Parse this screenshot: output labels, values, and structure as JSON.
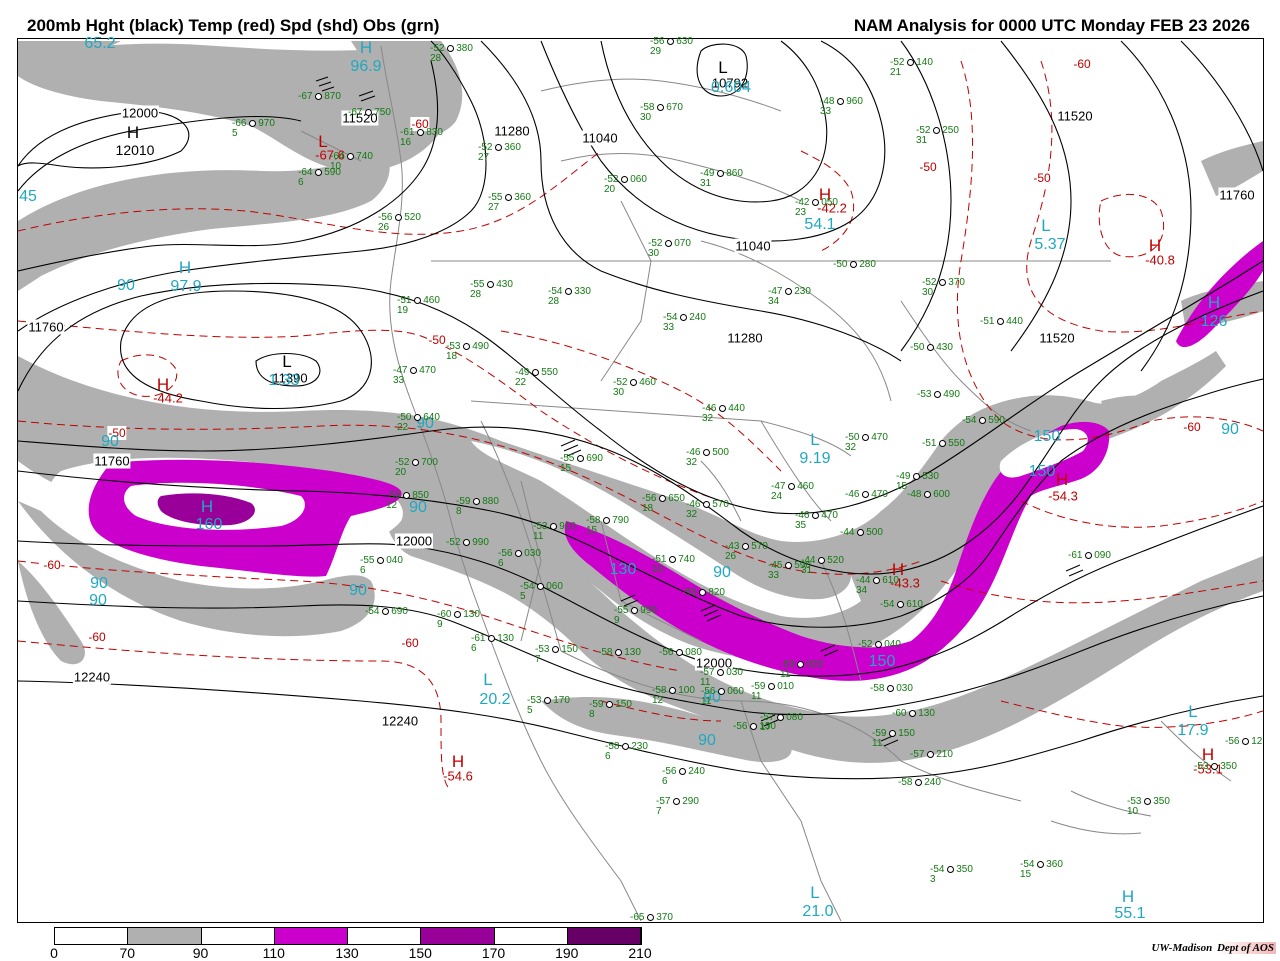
{
  "header": {
    "left_title": "200mb Hght (black) Temp (red) Spd (shd) Obs (grn)",
    "right_title": "NAM Analysis for 0000 UTC Monday  FEB 23 2026"
  },
  "colorbar": {
    "labels": [
      "0",
      "70",
      "90",
      "110",
      "130",
      "150",
      "170",
      "190",
      "210"
    ],
    "colors": [
      "#ffffff",
      "#b0b0b0",
      "#ffffff",
      "#cc00cc",
      "#ffffff",
      "#990099",
      "#ffffff",
      "#660066"
    ]
  },
  "credit": {
    "org": "UW-Madison",
    "dept": "Dept of AOS"
  },
  "colors": {
    "height": "#000000",
    "temp": "#c00000",
    "speed_label": "#20a8c0",
    "obs": "#137a13",
    "shade_70": "#b0b0b0",
    "shade_110": "#cc00cc",
    "shade_150": "#990099"
  },
  "centers": [
    {
      "type": "H",
      "value": "12010",
      "color": "height"
    },
    {
      "type": "H",
      "value": "-44.2",
      "color": "temp"
    },
    {
      "type": "L",
      "value": "11390",
      "color": "height"
    },
    {
      "type": "L",
      "value": "10792",
      "color": "height"
    },
    {
      "type": "L",
      "value": "-67.6",
      "color": "temp"
    },
    {
      "type": "H",
      "value": "-42.2",
      "color": "temp"
    },
    {
      "type": "H",
      "value": "-40.8",
      "color": "temp"
    },
    {
      "type": "H",
      "value": "-54.6",
      "color": "temp"
    },
    {
      "type": "H",
      "value": "-43.3",
      "color": "temp"
    },
    {
      "type": "H",
      "value": "-53.1",
      "color": "temp"
    },
    {
      "type": "H",
      "value": "-54.3",
      "color": "temp"
    },
    {
      "type": "H",
      "value": "96.9",
      "color": "speed"
    },
    {
      "type": "H",
      "value": "97.9",
      "color": "speed"
    },
    {
      "type": "H",
      "value": "160",
      "color": "speed"
    },
    {
      "type": "H",
      "value": "126",
      "color": "speed"
    },
    {
      "type": "H",
      "value": "55.1",
      "color": "speed"
    },
    {
      "type": "L",
      "value": "1.33",
      "color": "speed"
    },
    {
      "type": "L",
      "value": "0.604",
      "color": "speed"
    },
    {
      "type": "L",
      "value": "5.37",
      "color": "speed"
    },
    {
      "type": "L",
      "value": "9.19",
      "color": "speed"
    },
    {
      "type": "L",
      "value": "20.2",
      "color": "speed"
    },
    {
      "type": "L",
      "value": "17.9",
      "color": "speed"
    },
    {
      "type": "L",
      "value": "21.0",
      "color": "speed"
    },
    {
      "type": "L",
      "value": "54.1",
      "color": "speed"
    }
  ],
  "height_labels": [
    "12000",
    "12010",
    "11760",
    "11280",
    "11040",
    "11040",
    "11520",
    "11760",
    "11280",
    "11520",
    "12000",
    "12000",
    "12240",
    "12240",
    "11520",
    "11760"
  ],
  "temp_labels": [
    "-50",
    "-50",
    "-60",
    "-60",
    "-60",
    "-60",
    "-50",
    "-50",
    "-60",
    "-60"
  ],
  "speed_labels": [
    "65.2",
    "45",
    "90",
    "90",
    "90",
    "90",
    "90",
    "90",
    "90",
    "90",
    "90",
    "90",
    "90",
    "130",
    "150",
    "150",
    "150",
    "130",
    "150"
  ],
  "obs": [
    {
      "t": "-52",
      "h": "380",
      "d": "28"
    },
    {
      "t": "-56",
      "h": "630",
      "d": "29"
    },
    {
      "t": "-52",
      "h": "140",
      "d": "21"
    },
    {
      "t": "-67",
      "h": "870",
      "d": ""
    },
    {
      "t": "-67",
      "h": "750",
      "d": ""
    },
    {
      "t": "-66",
      "h": "970",
      "d": "5"
    },
    {
      "t": "-61",
      "h": "830",
      "d": "16"
    },
    {
      "t": "-58",
      "h": "670",
      "d": "30"
    },
    {
      "t": "-48",
      "h": "960",
      "d": "33"
    },
    {
      "t": "-52",
      "h": "250",
      "d": "31"
    },
    {
      "t": "-64",
      "h": "740",
      "d": "10"
    },
    {
      "t": "-64",
      "h": "590",
      "d": "6"
    },
    {
      "t": "-52",
      "h": "360",
      "d": "27"
    },
    {
      "t": "-52",
      "h": "060",
      "d": "20"
    },
    {
      "t": "-49",
      "h": "860",
      "d": "31"
    },
    {
      "t": "-55",
      "h": "360",
      "d": "27"
    },
    {
      "t": "-42",
      "h": "050",
      "d": "23"
    },
    {
      "t": "-56",
      "h": "520",
      "d": "26"
    },
    {
      "t": "-52",
      "h": "070",
      "d": "30"
    },
    {
      "t": "-50",
      "h": "280",
      "d": ""
    },
    {
      "t": "-52",
      "h": "370",
      "d": "30"
    },
    {
      "t": "-55",
      "h": "430",
      "d": "28"
    },
    {
      "t": "-54",
      "h": "330",
      "d": "28"
    },
    {
      "t": "-47",
      "h": "230",
      "d": "34"
    },
    {
      "t": "-51",
      "h": "460",
      "d": "19"
    },
    {
      "t": "-54",
      "h": "240",
      "d": "33"
    },
    {
      "t": "-51",
      "h": "440",
      "d": ""
    },
    {
      "t": "-53",
      "h": "490",
      "d": "18"
    },
    {
      "t": "-50",
      "h": "430",
      "d": ""
    },
    {
      "t": "-47",
      "h": "470",
      "d": "33"
    },
    {
      "t": "-49",
      "h": "550",
      "d": "22"
    },
    {
      "t": "-52",
      "h": "460",
      "d": "30"
    },
    {
      "t": "-53",
      "h": "490",
      "d": ""
    },
    {
      "t": "-46",
      "h": "440",
      "d": "32"
    },
    {
      "t": "-54",
      "h": "590",
      "d": ""
    },
    {
      "t": "-50",
      "h": "640",
      "d": "22"
    },
    {
      "t": "-50",
      "h": "470",
      "d": "32"
    },
    {
      "t": "-51",
      "h": "550",
      "d": ""
    },
    {
      "t": "-46",
      "h": "500",
      "d": "32"
    },
    {
      "t": "-52",
      "h": "700",
      "d": "20"
    },
    {
      "t": "-55",
      "h": "690",
      "d": "15"
    },
    {
      "t": "-49",
      "h": "530",
      "d": "15"
    },
    {
      "t": "-47",
      "h": "460",
      "d": "24"
    },
    {
      "t": "-46",
      "h": "470",
      "d": ""
    },
    {
      "t": "-48",
      "h": "600",
      "d": ""
    },
    {
      "t": "-56",
      "h": "850",
      "d": "12"
    },
    {
      "t": "-59",
      "h": "880",
      "d": "8"
    },
    {
      "t": "-56",
      "h": "650",
      "d": "18"
    },
    {
      "t": "-46",
      "h": "570",
      "d": "32"
    },
    {
      "t": "-46",
      "h": "470",
      "d": "35"
    },
    {
      "t": "-44",
      "h": "500",
      "d": ""
    },
    {
      "t": "-53",
      "h": "910",
      "d": "11"
    },
    {
      "t": "-58",
      "h": "790",
      "d": "15"
    },
    {
      "t": "-43",
      "h": "570",
      "d": "26"
    },
    {
      "t": "-45",
      "h": "590",
      "d": "33"
    },
    {
      "t": "-44",
      "h": "520",
      "d": "31"
    },
    {
      "t": "-44",
      "h": "610",
      "d": "34"
    },
    {
      "t": "-54",
      "h": "610",
      "d": ""
    },
    {
      "t": "-61",
      "h": "090",
      "d": ""
    },
    {
      "t": "-52",
      "h": "990",
      "d": ""
    },
    {
      "t": "-56",
      "h": "030",
      "d": "6"
    },
    {
      "t": "-51",
      "h": "740",
      "d": "10"
    },
    {
      "t": "-53",
      "h": "820",
      "d": ""
    },
    {
      "t": "-55",
      "h": "040",
      "d": "6"
    },
    {
      "t": "-54",
      "h": "060",
      "d": "5"
    },
    {
      "t": "-55",
      "h": "990",
      "d": "9"
    },
    {
      "t": "-54",
      "h": "690",
      "d": ""
    },
    {
      "t": "-60",
      "h": "130",
      "d": "9"
    },
    {
      "t": "-61",
      "h": "130",
      "d": "6"
    },
    {
      "t": "-53",
      "h": "150",
      "d": "7"
    },
    {
      "t": "-58",
      "h": "130",
      "d": ""
    },
    {
      "t": "-56",
      "h": "080",
      "d": ""
    },
    {
      "t": "-57",
      "h": "030",
      "d": "11"
    },
    {
      "t": "-53",
      "h": "020",
      "d": "11"
    },
    {
      "t": "-52",
      "h": "040",
      "d": ""
    },
    {
      "t": "-58",
      "h": "030",
      "d": ""
    },
    {
      "t": "-58",
      "h": "100",
      "d": "12"
    },
    {
      "t": "-56",
      "h": "060",
      "d": "11"
    },
    {
      "t": "-59",
      "h": "010",
      "d": "11"
    },
    {
      "t": "-53",
      "h": "170",
      "d": "5"
    },
    {
      "t": "-59",
      "h": "150",
      "d": "8"
    },
    {
      "t": "-56",
      "h": "130",
      "d": ""
    },
    {
      "t": "-57",
      "h": "080",
      "d": "17"
    },
    {
      "t": "-60",
      "h": "130",
      "d": ""
    },
    {
      "t": "-59",
      "h": "150",
      "d": "11"
    },
    {
      "t": "-58",
      "h": "230",
      "d": "6"
    },
    {
      "t": "-57",
      "h": "210",
      "d": ""
    },
    {
      "t": "-56",
      "h": "240",
      "d": "6"
    },
    {
      "t": "-58",
      "h": "240",
      "d": ""
    },
    {
      "t": "-57",
      "h": "290",
      "d": "7"
    },
    {
      "t": "-53",
      "h": "350",
      "d": ""
    },
    {
      "t": "-53",
      "h": "350",
      "d": "10"
    },
    {
      "t": "-56",
      "h": "12",
      "d": ""
    },
    {
      "t": "-54",
      "h": "350",
      "d": "3"
    },
    {
      "t": "-54",
      "h": "360",
      "d": "15"
    },
    {
      "t": "-65",
      "h": "370",
      "d": ""
    }
  ]
}
